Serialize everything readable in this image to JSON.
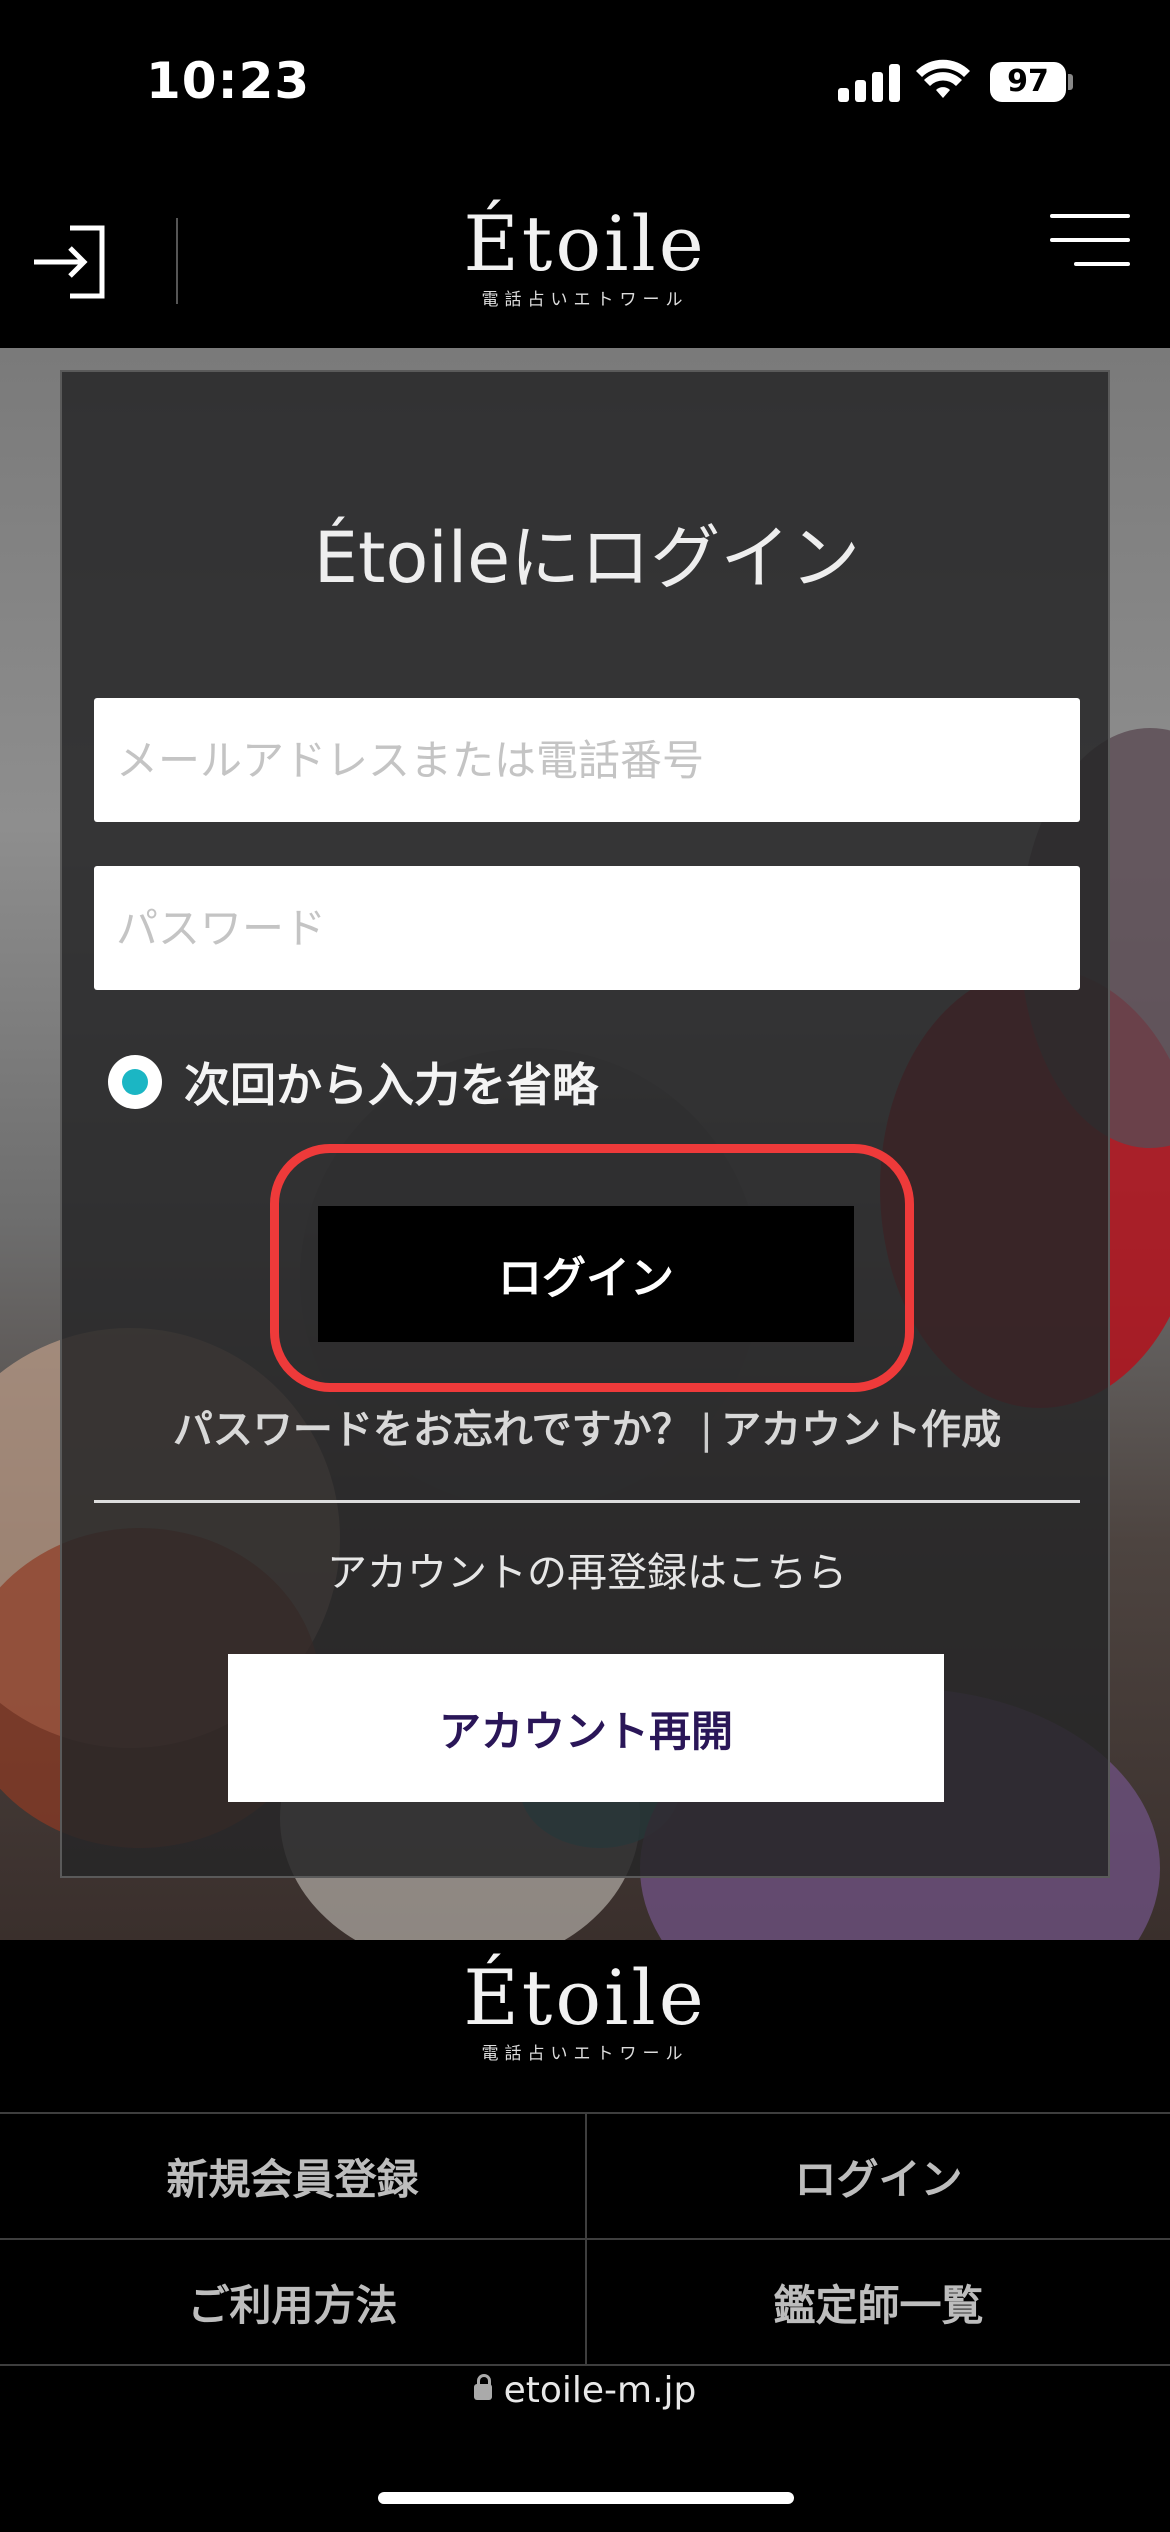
{
  "status_bar": {
    "time": "10:23",
    "battery": "97",
    "icons": [
      "signal-icon",
      "wifi-icon",
      "battery-icon"
    ]
  },
  "header": {
    "logo_main": "Étoile",
    "logo_sub": "電話占いエトワール",
    "icons": [
      "login-icon",
      "hamburger-menu-icon"
    ]
  },
  "login_card": {
    "title": "Étoileにログイン",
    "email_placeholder": "メールアドレスまたは電話番号",
    "password_placeholder": "パスワード",
    "remember_label": "次回から入力を省略",
    "remember_checked": true,
    "login_button": "ログイン",
    "forgot_password": "パスワードをお忘れですか？",
    "link_separator": "|",
    "create_account": "アカウント作成",
    "reregister_text": "アカウントの再登録はこちら",
    "reopen_button": "アカウント再開"
  },
  "footer": {
    "logo_main": "Étoile",
    "logo_sub": "電話占いエトワール",
    "links": [
      [
        "新規会員登録",
        "ログイン"
      ],
      [
        "ご利用方法",
        "鑑定師一覧"
      ]
    ]
  },
  "browser": {
    "url": "etoile-m.jp"
  },
  "colors": {
    "highlight": "#ee3a3a",
    "radio_accent": "#1bb6c4",
    "reopen_text": "#2a1658"
  }
}
